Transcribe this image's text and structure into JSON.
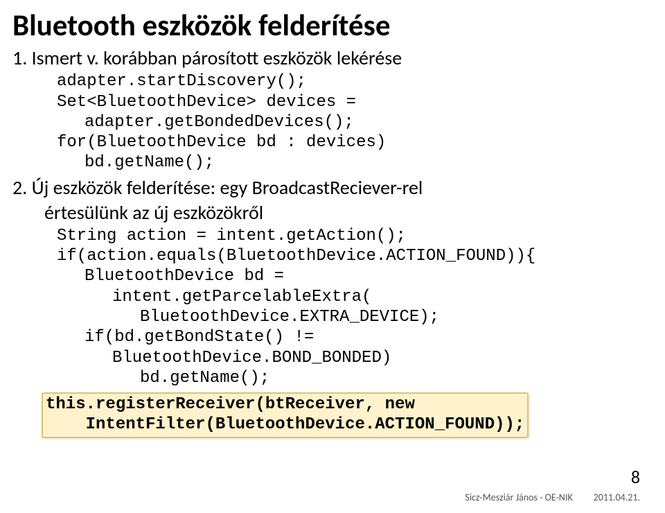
{
  "title": "Bluetooth eszközök felderítése",
  "item1": {
    "num": "1.",
    "text": "Ismert v. korábban párosított eszközök lekérése"
  },
  "code1": {
    "l1": "adapter.startDiscovery();",
    "l2": "Set<BluetoothDevice> devices =",
    "l3": "adapter.getBondedDevices();",
    "l4": "for(BluetoothDevice bd : devices)",
    "l5": "bd.getName();"
  },
  "item2": {
    "num": "2.",
    "text_a": "Új eszközök felderítése: egy BroadcastReciever-rel",
    "text_b": "értesülünk az új eszközökről"
  },
  "code2": {
    "l1": "String action = intent.getAction();",
    "l2": "if(action.equals(BluetoothDevice.ACTION_FOUND)){",
    "l3": "BluetoothDevice bd = ",
    "l4": "intent.getParcelableExtra(",
    "l5": "BluetoothDevice.EXTRA_DEVICE);",
    "l6": "if(bd.getBondState() != ",
    "l7": "BluetoothDevice.BOND_BONDED)",
    "l8": "bd.getName();"
  },
  "highlight": {
    "l1": "this.registerReceiver(btReceiver, new",
    "l2": "    IntentFilter(BluetoothDevice.ACTION_FOUND));"
  },
  "footer": {
    "author": "Sicz-Mesziár János - OE-NIK",
    "date": "2011.04.21."
  },
  "page": "8"
}
